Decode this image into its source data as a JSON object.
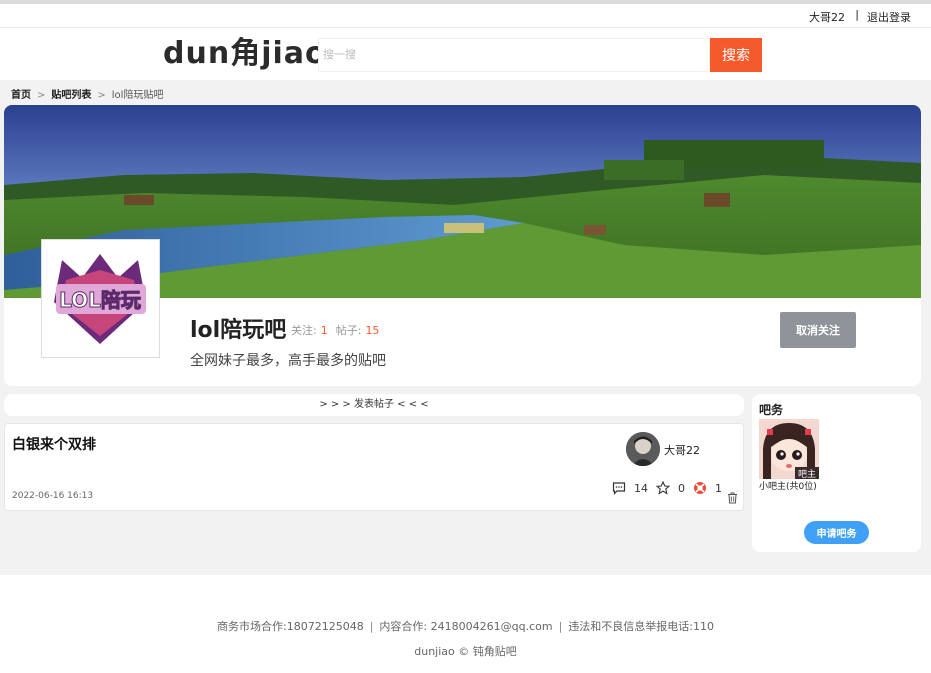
{
  "topbar": {
    "username": "大哥22",
    "separator": "|",
    "logout_label": "退出登录"
  },
  "header": {
    "logo_text": "dun角jiao",
    "logo_prefix": "dun",
    "logo_char": "角",
    "logo_suffix": "jiao",
    "search_placeholder": "搜一搜",
    "search_button": "搜索"
  },
  "breadcrumb": {
    "items": [
      "首页",
      "贴吧列表",
      "lol陪玩贴吧"
    ],
    "separator": ">"
  },
  "bar": {
    "name": "lol陪玩吧",
    "avatar_text": "LOL陪玩",
    "follow_label": "关注:",
    "follow_count": "1",
    "posts_label": "帖子:",
    "posts_count": "15",
    "description": "全网妹子最多，高手最多的贴吧",
    "unfollow_button": "取消关注"
  },
  "post_bar": {
    "label": "> > >  发表帖子  < < <"
  },
  "posts": [
    {
      "title": "白银来个双排",
      "author": "大哥22",
      "date": "2022-06-16 16:13",
      "comments": "14",
      "stars": "0",
      "lifebuoy": "1"
    }
  ],
  "sidebar": {
    "title": "吧务",
    "mod_badge": "吧主",
    "mod_label": "小吧主(共0位)",
    "apply_button": "申请吧务"
  },
  "footer": {
    "business": "商务市场合作:18072125048",
    "content": "内容合作: 2418004261@qq.com",
    "report": "违法和不良信息举报电话:110",
    "separator": "|",
    "copyright": "dunjiao © 钝角贴吧"
  },
  "colors": {
    "accent": "#f55a2c",
    "primary_button": "#3fa0f5",
    "muted_button": "#8f949b"
  }
}
